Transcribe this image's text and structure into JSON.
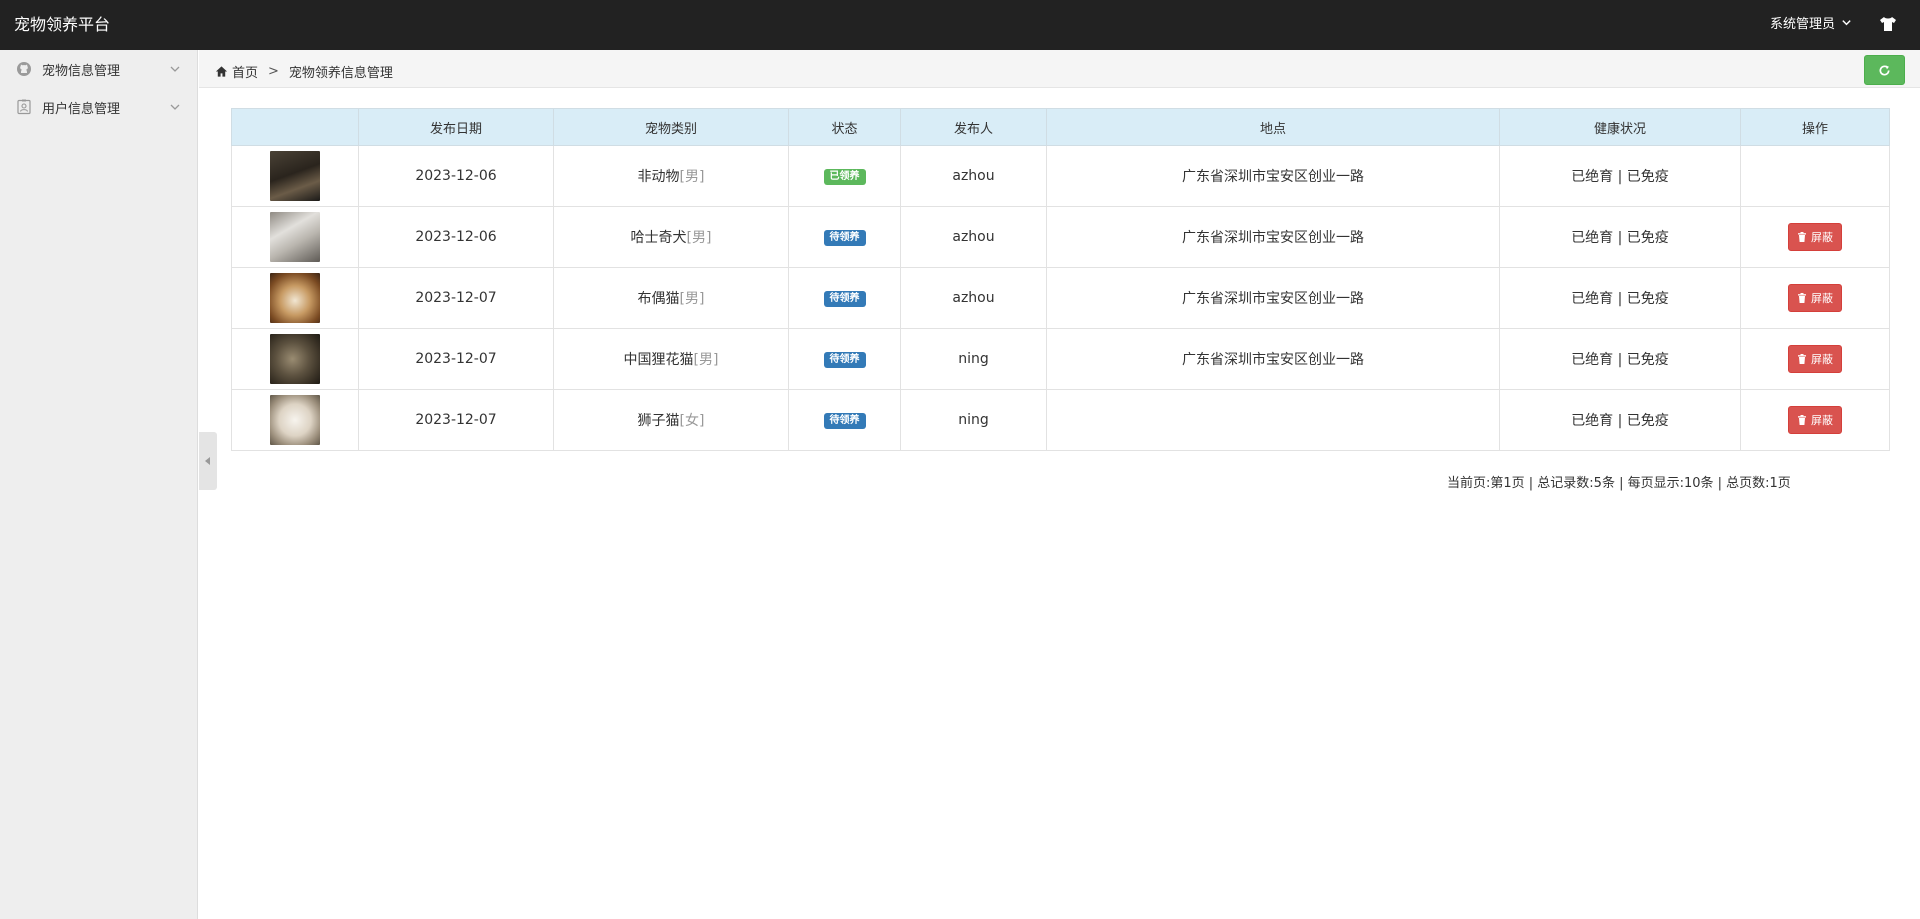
{
  "app": {
    "title": "宠物领养平台",
    "user": "系统管理员"
  },
  "sidebar": {
    "items": [
      {
        "label": "宠物信息管理"
      },
      {
        "label": "用户信息管理"
      }
    ]
  },
  "breadcrumb": {
    "home": "首页",
    "separator": ">",
    "current": "宠物领养信息管理"
  },
  "table": {
    "headers": [
      "",
      "发布日期",
      "宠物类别",
      "状态",
      "发布人",
      "地点",
      "健康状况",
      "操作"
    ],
    "rows": [
      {
        "date": "2023-12-06",
        "category": "非动物",
        "gender": "[男]",
        "status": "已领养",
        "publisher": "azhou",
        "location": "广东省深圳市宝安区创业一路",
        "health": "已绝育 | 已免疫",
        "action": ""
      },
      {
        "date": "2023-12-06",
        "category": "哈士奇犬",
        "gender": "[男]",
        "status": "待领养",
        "publisher": "azhou",
        "location": "广东省深圳市宝安区创业一路",
        "health": "已绝育 | 已免疫",
        "action": "屏蔽"
      },
      {
        "date": "2023-12-07",
        "category": "布偶猫",
        "gender": "[男]",
        "status": "待领养",
        "publisher": "azhou",
        "location": "广东省深圳市宝安区创业一路",
        "health": "已绝育 | 已免疫",
        "action": "屏蔽"
      },
      {
        "date": "2023-12-07",
        "category": "中国狸花猫",
        "gender": "[男]",
        "status": "待领养",
        "publisher": "ning",
        "location": "广东省深圳市宝安区创业一路",
        "health": "已绝育 | 已免疫",
        "action": "屏蔽"
      },
      {
        "date": "2023-12-07",
        "category": "狮子猫",
        "gender": "[女]",
        "status": "待领养",
        "publisher": "ning",
        "location": "",
        "health": "已绝育 | 已免疫",
        "action": "屏蔽"
      }
    ]
  },
  "pager": {
    "text": "当前页:第1页 | 总记录数:5条 | 每页显示:10条 | 总页数:1页"
  },
  "colors": {
    "topbar": "#222222",
    "header_row": "#d9edf7",
    "adopted": "#5cb85c",
    "pending": "#337ab7",
    "danger": "#d9534f"
  },
  "icons": {
    "sidebar_0": "github-icon",
    "sidebar_1": "id-card-icon",
    "home": "home-icon",
    "refresh": "refresh-icon",
    "skin": "tshirt-icon",
    "block": "trash-icon"
  }
}
